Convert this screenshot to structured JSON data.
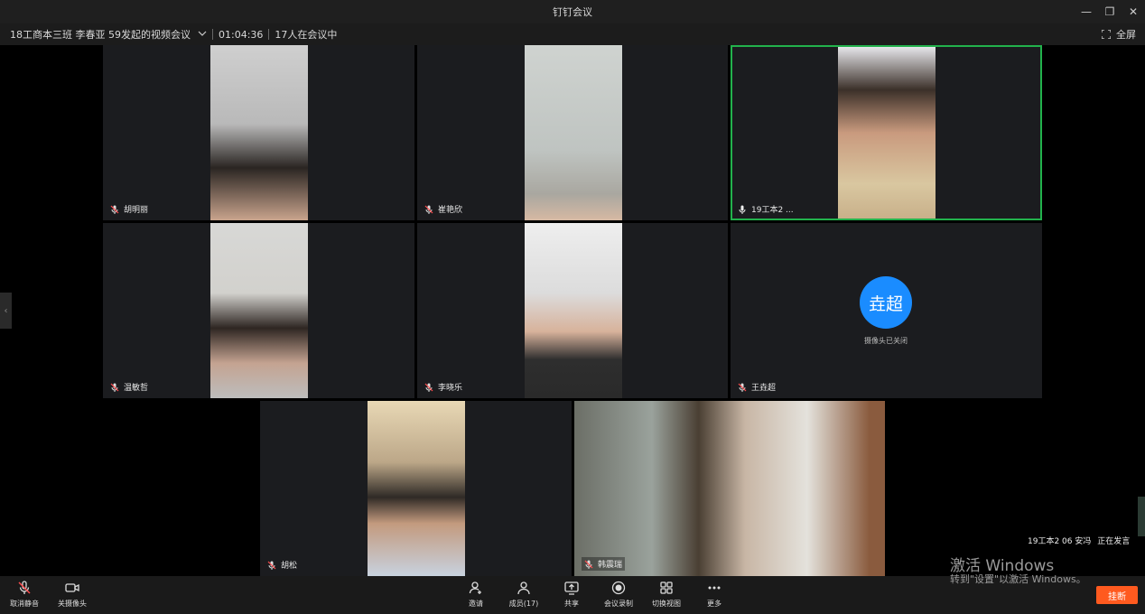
{
  "window": {
    "title": "钉钉会议",
    "minimize": "—",
    "restore": "❐",
    "close": "✕"
  },
  "meeting": {
    "name": "18工商本三班 李春亚 59发起的视频会议",
    "duration": "01:04:36",
    "participants_text": "17人在会议中",
    "fullscreen_label": "全屏"
  },
  "participants": [
    {
      "name": "胡明丽"
    },
    {
      "name": "崔艳欣"
    },
    {
      "name": "19工本2 ..."
    },
    {
      "name": "温敏哲"
    },
    {
      "name": "李晓乐"
    },
    {
      "name": "王垚超",
      "avatar_text": "垚超",
      "camera_off_text": "摄像头已关闭"
    },
    {
      "name": "胡松"
    },
    {
      "name": "韩震瑞"
    }
  ],
  "speaking": {
    "name": "19工本2 06 安冯",
    "status": "正在发言"
  },
  "toolbar": {
    "unmute": "取消静音",
    "camera_off": "关摄像头",
    "invite": "邀请",
    "members": "成员(17)",
    "share": "共享",
    "record": "会议录制",
    "switch_view": "切换视图",
    "more": "更多",
    "hangup": "挂断"
  },
  "watermark": {
    "line1": "激活 Windows",
    "line2": "转到\"设置\"以激活 Windows。"
  },
  "colors": {
    "active_border": "#22b24c",
    "avatar_bg": "#1a8cff",
    "hangup_bg": "#ff5a1f"
  }
}
